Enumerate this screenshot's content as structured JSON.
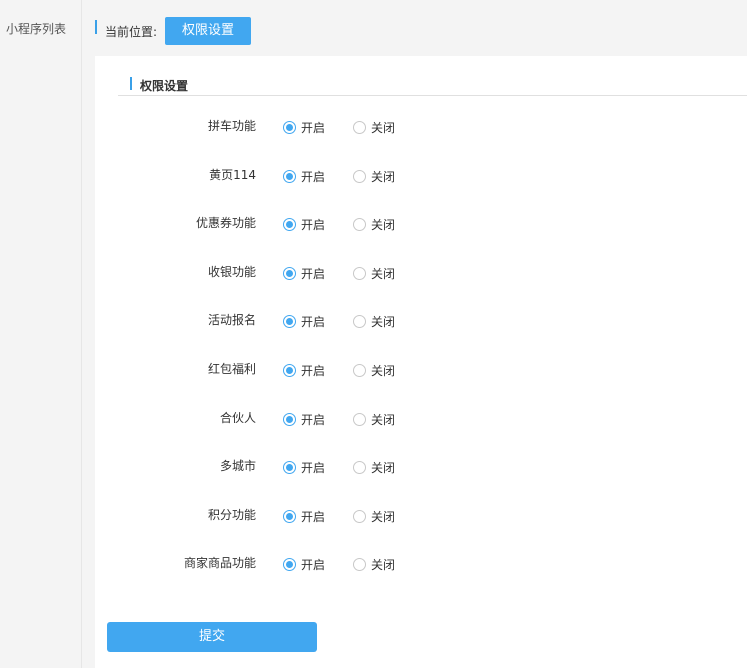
{
  "sidebar": {
    "items": [
      {
        "label": "小程序列表"
      }
    ]
  },
  "breadcrumb": {
    "label": "当前位置:",
    "current": "权限设置"
  },
  "section": {
    "title": "权限设置"
  },
  "options": {
    "on": "开启",
    "off": "关闭"
  },
  "permissions": [
    {
      "label": "拼车功能",
      "selected": "on"
    },
    {
      "label": "黄页114",
      "selected": "on"
    },
    {
      "label": "优惠券功能",
      "selected": "on"
    },
    {
      "label": "收银功能",
      "selected": "on"
    },
    {
      "label": "活动报名",
      "selected": "on"
    },
    {
      "label": "红包福利",
      "selected": "on"
    },
    {
      "label": "合伙人",
      "selected": "on"
    },
    {
      "label": "多城市",
      "selected": "on"
    },
    {
      "label": "积分功能",
      "selected": "on"
    },
    {
      "label": "商家商品功能",
      "selected": "on"
    }
  ],
  "submit_label": "提交",
  "colors": {
    "accent": "#41a7f0",
    "bar": "#3aa0e8"
  }
}
